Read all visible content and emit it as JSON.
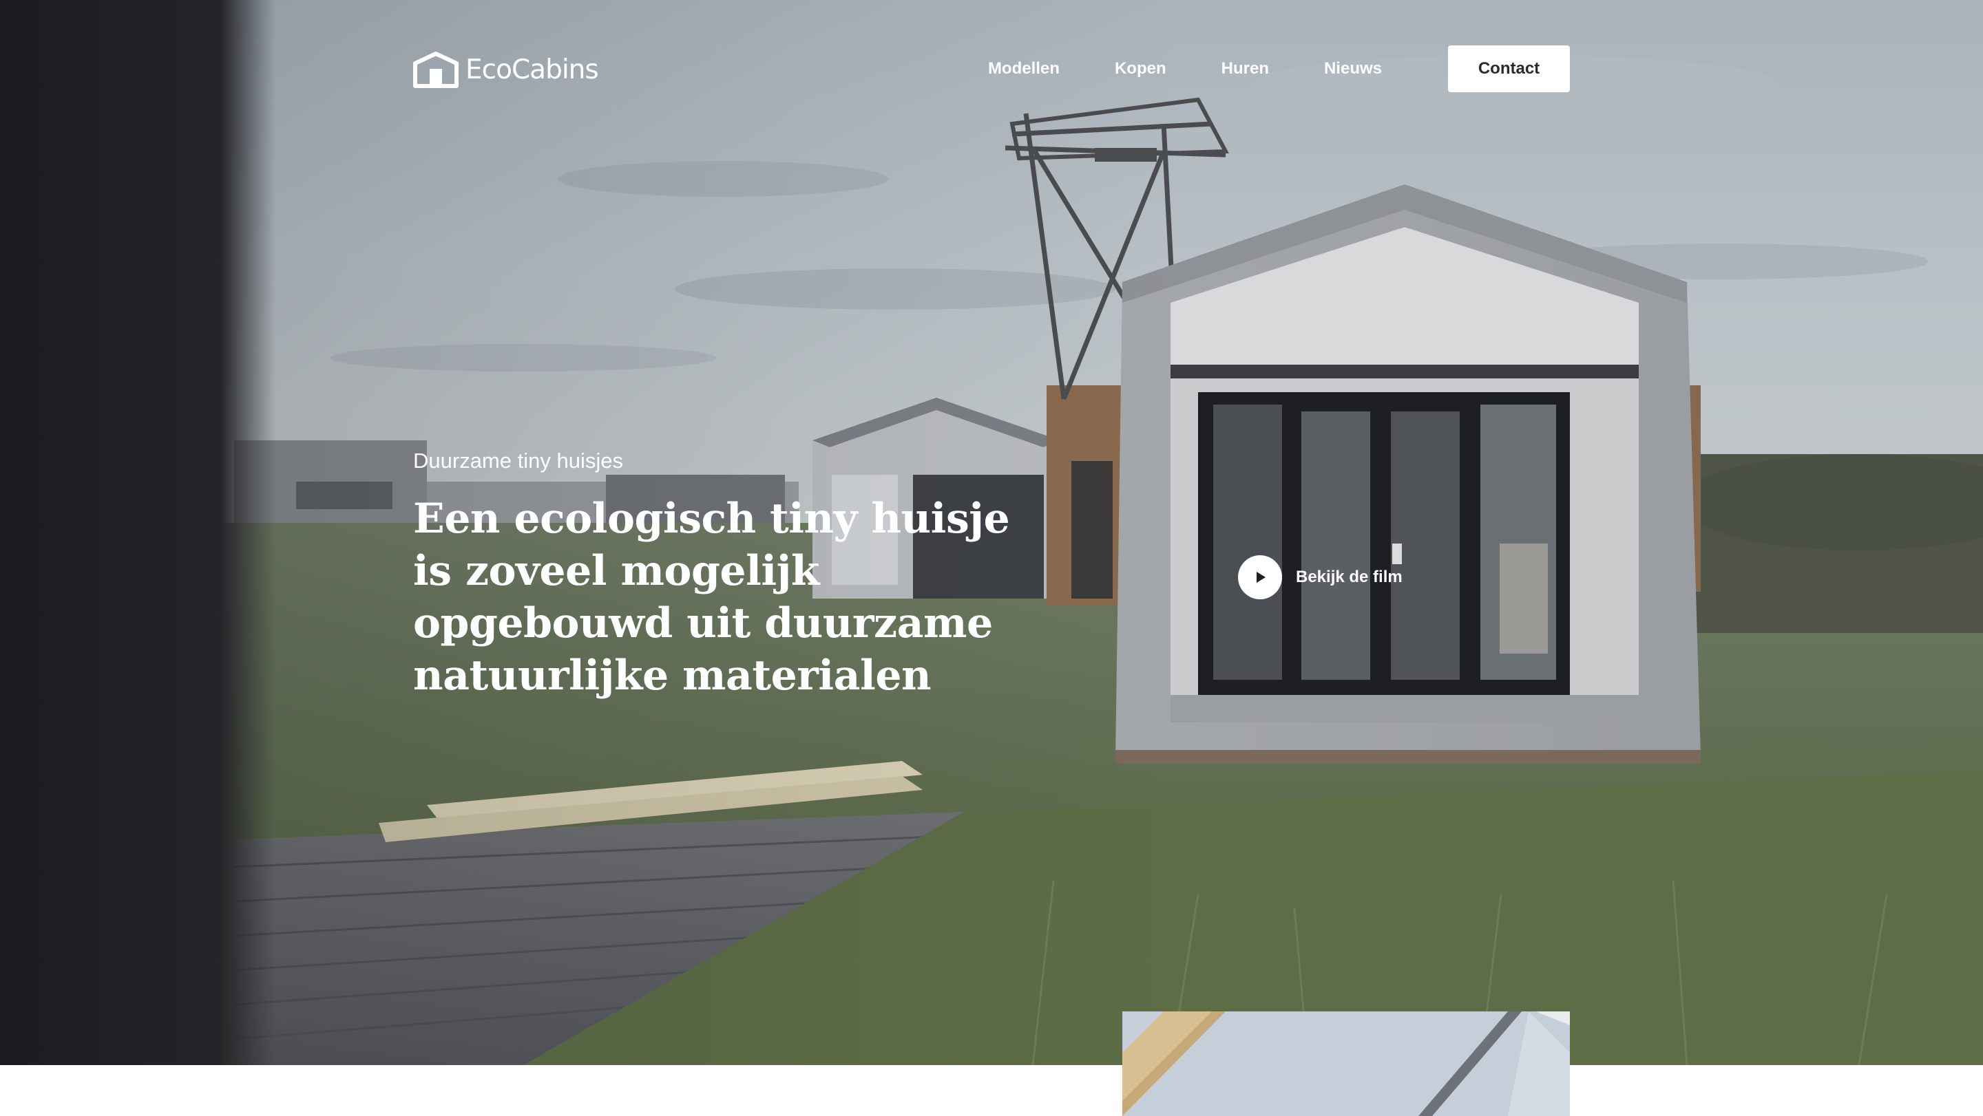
{
  "brand": {
    "name": "EcoCabins",
    "logo_icon": "cabin-house-icon"
  },
  "nav": {
    "items": [
      {
        "label": "Modellen"
      },
      {
        "label": "Kopen"
      },
      {
        "label": "Huren"
      },
      {
        "label": "Nieuws"
      }
    ],
    "contact_label": "Contact"
  },
  "hero": {
    "eyebrow": "Duurzame tiny huisjes",
    "headline": "Een ecologisch tiny huisje is zoveel mogelijk opgebouwd uit duurzame natuurlijke materialen",
    "video_cta": {
      "label": "Bekijk de film",
      "icon": "play-icon"
    },
    "background": "photo-tiny-houses-on-grass-field"
  },
  "preview_card": {
    "image": "photo-cabin-interior-ceiling"
  },
  "colors": {
    "text_on_hero": "#ffffff",
    "button_bg": "#ffffff",
    "button_text": "#2b2b2b",
    "page_bg": "#ffffff"
  }
}
